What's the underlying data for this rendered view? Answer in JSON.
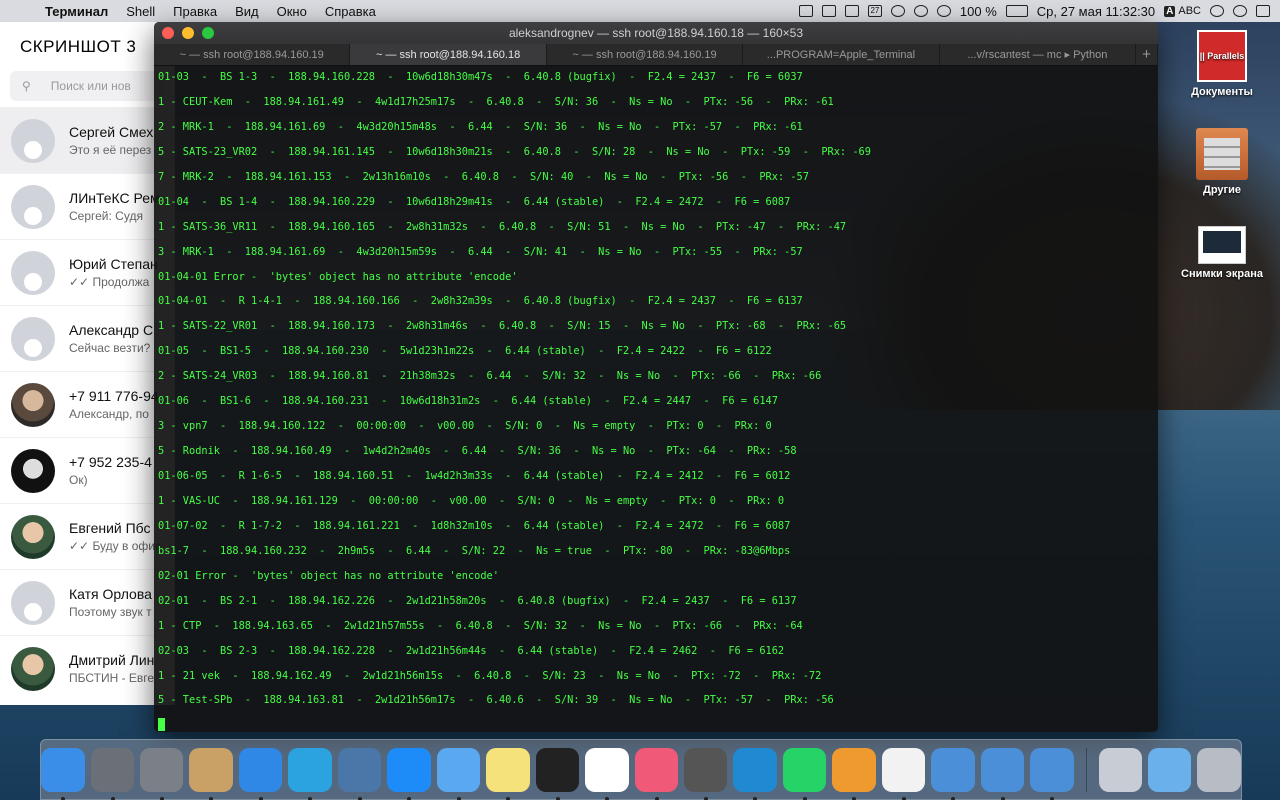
{
  "menubar": {
    "app": "Терминал",
    "menus": [
      "Shell",
      "Правка",
      "Вид",
      "Окно",
      "Справка"
    ],
    "battery": "100 %",
    "calendar_day": "27",
    "input_source": "ABC",
    "datetime": "Ср, 27 мая  11:32:30"
  },
  "messenger": {
    "title": "СКРИНШОТ 3",
    "search_placeholder": "Поиск или нов",
    "chats": [
      {
        "name": "Сергей Смех",
        "last": "Это я её перез"
      },
      {
        "name": "ЛИнТеКС Рем",
        "last": "Сергей: Судя"
      },
      {
        "name": "Юрий Степан",
        "last": "✓✓ Продолжа"
      },
      {
        "name": "Александр С",
        "last": "Сейчас везти?"
      },
      {
        "name": "+7 911 776-94",
        "last": "Александр, по"
      },
      {
        "name": "+7 952 235-4",
        "last": "Ок)"
      },
      {
        "name": "Евгений  Пбс",
        "last": "✓✓ Буду в офис"
      },
      {
        "name": "Катя Орлова",
        "last": "Поэтому звук т"
      },
      {
        "name": "Дмитрий Лин",
        "last": "ПБСТИН - Евге"
      }
    ]
  },
  "terminal": {
    "window_title": "aleksandrognev — ssh root@188.94.160.18 — 160×53",
    "tabs": [
      "~ — ssh root@188.94.160.19",
      "~ — ssh root@188.94.160.18",
      "~ — ssh root@188.94.160.19",
      "...PROGRAM=Apple_Terminal",
      "...v/rscantest — mc ▸ Python"
    ],
    "lines": [
      "01-03  -  BS 1-3  -  188.94.160.228  -  10w6d18h30m47s  -  6.40.8 (bugfix)  -  F2.4 = 2437  -  F6 = 6037",
      "1 - CEUT-Kem  -  188.94.161.49  -  4w1d17h25m17s  -  6.40.8  -  S/N: 36  -  Ns = No  -  PTx: -56  -  PRx: -61",
      "2 - MRK-1  -  188.94.161.69  -  4w3d20h15m48s  -  6.44  -  S/N: 36  -  Ns = No  -  PTx: -57  -  PRx: -61",
      "5 - SATS-23_VR02  -  188.94.161.145  -  10w6d18h30m21s  -  6.40.8  -  S/N: 28  -  Ns = No  -  PTx: -59  -  PRx: -69",
      "7 - MRK-2  -  188.94.161.153  -  2w13h16m10s  -  6.40.8  -  S/N: 40  -  Ns = No  -  PTx: -56  -  PRx: -57",
      "01-04  -  BS 1-4  -  188.94.160.229  -  10w6d18h29m41s  -  6.44 (stable)  -  F2.4 = 2472  -  F6 = 6087",
      "1 - SATS-36_VR11  -  188.94.160.165  -  2w8h31m32s  -  6.40.8  -  S/N: 51  -  Ns = No  -  PTx: -47  -  PRx: -47",
      "3 - MRK-1  -  188.94.161.69  -  4w3d20h15m59s  -  6.44  -  S/N: 41  -  Ns = No  -  PTx: -55  -  PRx: -57",
      "01-04-01 Error -  'bytes' object has no attribute 'encode'",
      "01-04-01  -  R 1-4-1  -  188.94.160.166  -  2w8h32m39s  -  6.40.8 (bugfix)  -  F2.4 = 2437  -  F6 = 6137",
      "1 - SATS-22_VR01  -  188.94.160.173  -  2w8h31m46s  -  6.40.8  -  S/N: 15  -  Ns = No  -  PTx: -68  -  PRx: -65",
      "01-05  -  BS1-5  -  188.94.160.230  -  5w1d23h1m22s  -  6.44 (stable)  -  F2.4 = 2422  -  F6 = 6122",
      "2 - SATS-24_VR03  -  188.94.160.81  -  21h38m32s  -  6.44  -  S/N: 32  -  Ns = No  -  PTx: -66  -  PRx: -66",
      "01-06  -  BS1-6  -  188.94.160.231  -  10w6d18h31m2s  -  6.44 (stable)  -  F2.4 = 2447  -  F6 = 6147",
      "3 - vpn7  -  188.94.160.122  -  00:00:00  -  v00.00  -  S/N: 0  -  Ns = empty  -  PTx: 0  -  PRx: 0",
      "5 - Rodnik  -  188.94.160.49  -  1w4d2h2m40s  -  6.44  -  S/N: 36  -  Ns = No  -  PTx: -64  -  PRx: -58",
      "01-06-05  -  R 1-6-5  -  188.94.160.51  -  1w4d2h3m33s  -  6.44 (stable)  -  F2.4 = 2412  -  F6 = 6012",
      "1 - VAS-UC  -  188.94.161.129  -  00:00:00  -  v00.00  -  S/N: 0  -  Ns = empty  -  PTx: 0  -  PRx: 0",
      "01-07-02  -  R 1-7-2  -  188.94.161.221  -  1d8h32m10s  -  6.44 (stable)  -  F2.4 = 2472  -  F6 = 6087",
      "bs1-7  -  188.94.160.232  -  2h9m5s  -  6.44  -  S/N: 22  -  Ns = true  -  PTx: -80  -  PRx: -83@6Mbps",
      "02-01 Error -  'bytes' object has no attribute 'encode'",
      "02-01  -  BS 2-1  -  188.94.162.226  -  2w1d21h58m20s  -  6.40.8 (bugfix)  -  F2.4 = 2437  -  F6 = 6137",
      "1 - CTP  -  188.94.163.65  -  2w1d21h57m55s  -  6.40.8  -  S/N: 32  -  Ns = No  -  PTx: -66  -  PRx: -64",
      "02-03  -  BS 2-3  -  188.94.162.228  -  2w1d21h56m44s  -  6.44 (stable)  -  F2.4 = 2462  -  F6 = 6162",
      "1 - 21 vek  -  188.94.162.49  -  2w1d21h56m15s  -  6.40.8  -  S/N: 23  -  Ns = No  -  PTx: -72  -  PRx: -72",
      "5 - Test-SPb  -  188.94.163.81  -  2w1d21h56m17s  -  6.40.6  -  S/N: 39  -  Ns = No  -  PTx: -57  -  PRx: -56"
    ]
  },
  "desktop": {
    "icons": [
      {
        "label": "Документы",
        "badge": "|| Parallels"
      },
      {
        "label": "Другие"
      },
      {
        "label": "Снимки экрана"
      }
    ]
  },
  "dock": {
    "apps": [
      "finder-icon",
      "launchpad-icon",
      "system-preferences-icon",
      "mail-stamp-icon",
      "safari-icon",
      "telegram-icon",
      "vk-icon",
      "messenger-icon",
      "messages-icon",
      "notes-icon",
      "terminal-icon",
      "photos-icon",
      "music-icon",
      "disk-utility-icon",
      "vscode-icon",
      "whatsapp-icon",
      "sublime-icon",
      "document-icon",
      "winbox-icon",
      "winbox-icon-2",
      "winbox-icon-3",
      "downloads-icon",
      "applications-folder-icon",
      "trash-icon"
    ]
  }
}
